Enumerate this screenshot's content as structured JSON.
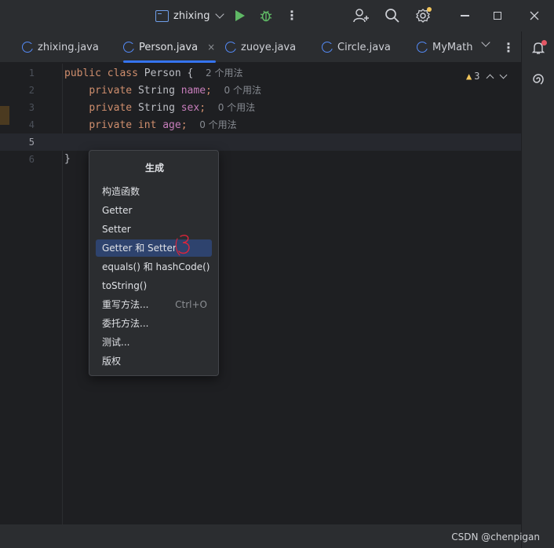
{
  "titlebar": {
    "project_name": "zhixing",
    "icons": [
      "project-icon",
      "chevron-down-icon",
      "run-icon",
      "debug-icon",
      "more-icon",
      "add-user-icon",
      "search-icon",
      "settings-icon",
      "minimize-icon",
      "maximize-icon",
      "close-icon"
    ]
  },
  "tabs": [
    {
      "label": "zhixing.java",
      "active": false
    },
    {
      "label": "Person.java",
      "active": true
    },
    {
      "label": "zuoye.java",
      "active": false
    },
    {
      "label": "Circle.java",
      "active": false
    },
    {
      "label": "MyMath",
      "active": false
    }
  ],
  "tab_close": "×",
  "inspections": {
    "warning_count": "3"
  },
  "code": [
    {
      "num": "1",
      "hint": "2 个用法"
    },
    {
      "num": "2",
      "hint": "0 个用法"
    },
    {
      "num": "3",
      "hint": "0 个用法"
    },
    {
      "num": "4",
      "hint": "0 个用法"
    },
    {
      "num": "5",
      "hint": ""
    },
    {
      "num": "6",
      "hint": ""
    }
  ],
  "code_text": {
    "l1_kw": "public class",
    "l1_name": "Person {",
    "l2_kw": "private",
    "l2_type": "String",
    "l2_field": "name",
    "l3_kw": "private",
    "l3_type": "String",
    "l3_field": "sex",
    "l4_kw": "private int",
    "l4_field": "age",
    "semicolon": ";",
    "l6": "}"
  },
  "popup": {
    "title": "生成",
    "items": [
      {
        "label": "构造函数",
        "shortcut": ""
      },
      {
        "label": "Getter",
        "shortcut": ""
      },
      {
        "label": "Setter",
        "shortcut": ""
      },
      {
        "label": "Getter 和 Setter",
        "shortcut": "",
        "selected": true
      },
      {
        "label": "equals() 和 hashCode()",
        "shortcut": ""
      },
      {
        "label": "toString()",
        "shortcut": ""
      },
      {
        "label": "重写方法...",
        "shortcut": "Ctrl+O"
      },
      {
        "label": "委托方法...",
        "shortcut": ""
      },
      {
        "label": "测试...",
        "shortcut": ""
      },
      {
        "label": "版权",
        "shortcut": ""
      }
    ]
  },
  "watermark": "CSDN @chenpigan",
  "colors": {
    "accent": "#3574f0",
    "keyword": "#cf8e6d",
    "field": "#c77dbb",
    "selection": "#2e436e",
    "annotation": "#e0243a"
  }
}
